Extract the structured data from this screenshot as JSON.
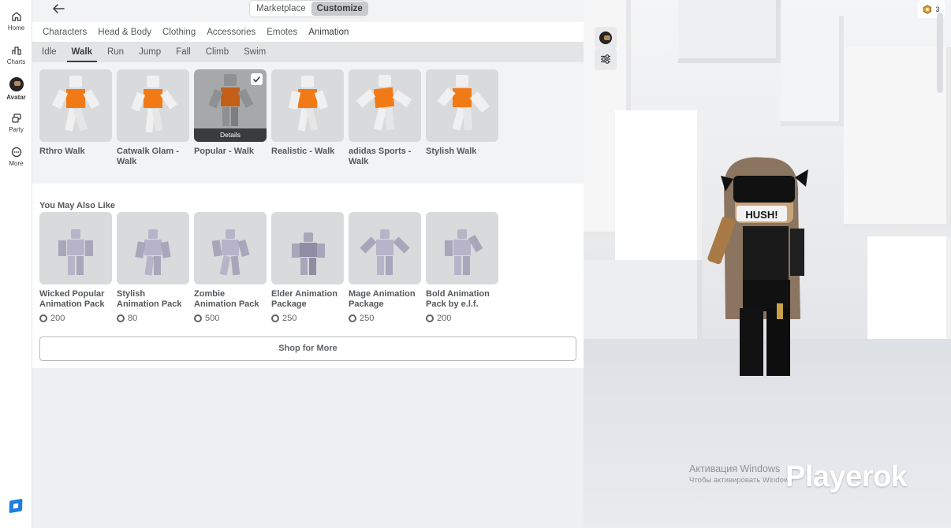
{
  "nav": {
    "items": [
      {
        "label": "Home"
      },
      {
        "label": "Charts"
      },
      {
        "label": "Avatar"
      },
      {
        "label": "Party"
      },
      {
        "label": "More"
      }
    ]
  },
  "topbar": {
    "segments": [
      "Marketplace",
      "Customize"
    ]
  },
  "category_tabs": [
    "Characters",
    "Head & Body",
    "Clothing",
    "Accessories",
    "Emotes",
    "Animation"
  ],
  "sub_tabs": [
    "Idle",
    "Walk",
    "Run",
    "Jump",
    "Fall",
    "Climb",
    "Swim"
  ],
  "owned": {
    "items": [
      {
        "name": "Rthro Walk"
      },
      {
        "name": "Catwalk Glam - Walk"
      },
      {
        "name": "Popular - Walk"
      },
      {
        "name": "Realistic - Walk"
      },
      {
        "name": "adidas Sports - Walk"
      },
      {
        "name": "Stylish Walk"
      }
    ],
    "details_label": "Details"
  },
  "suggestions": {
    "title": "You May Also Like",
    "items": [
      {
        "name": "Wicked Popular Animation Pack",
        "price": "200"
      },
      {
        "name": "Stylish Animation Pack",
        "price": "80"
      },
      {
        "name": "Zombie Animation Pack",
        "price": "500"
      },
      {
        "name": "Elder Animation Package",
        "price": "250"
      },
      {
        "name": "Mage Animation Package",
        "price": "250"
      },
      {
        "name": "Bold Animation Pack by e.l.f.",
        "price": "200"
      }
    ],
    "shop_label": "Shop for More"
  },
  "viewport": {
    "robux_balance": "3",
    "avatar_mask_text": "HUSH!",
    "windows_activation": {
      "line1": "Активация Windows",
      "line2": "Чтобы активировать Windows"
    },
    "watermark": "Playerok"
  },
  "colors": {
    "accent_orange": "#f27a16",
    "figure_white": "#f0f0f0",
    "figure_lavender": "#b7b4c9",
    "selected_tab_underline": "#393b3d"
  }
}
